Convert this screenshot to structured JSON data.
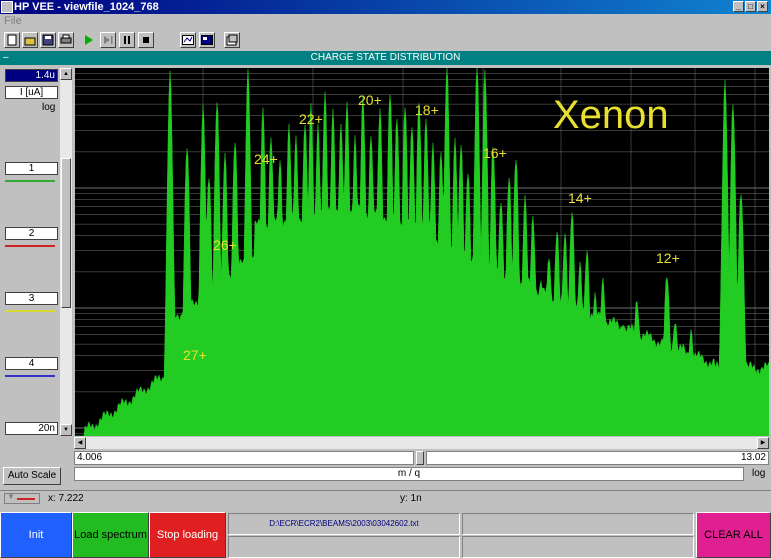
{
  "window": {
    "title": "HP VEE - viewfile_1024_768"
  },
  "menu": {
    "file": "File"
  },
  "panel": {
    "title": "CHARGE STATE DISTRIBUTION"
  },
  "yaxis": {
    "max": "1.4u",
    "unit": "I [uA]",
    "scale": "log",
    "min": "20n"
  },
  "traces": [
    {
      "label": "1",
      "color": "#33aa33"
    },
    {
      "label": "2",
      "color": "#cc2222"
    },
    {
      "label": "3",
      "color": "#d8d833"
    },
    {
      "label": "4",
      "color": "#3333cc"
    }
  ],
  "xaxis": {
    "min": "4.006",
    "max": "13.02",
    "label": "m / q",
    "scale": "log"
  },
  "plot": {
    "element_label": "Xenon",
    "charge_labels": [
      "27+",
      "26+",
      "24+",
      "22+",
      "20+",
      "18+",
      "16+",
      "14+",
      "12+"
    ]
  },
  "controls": {
    "auto_scale": "Auto Scale"
  },
  "status": {
    "x_readout": "x: 7.222",
    "y_readout": "y: 1n"
  },
  "buttons": {
    "init": "Init",
    "load": "Load spectrum",
    "stop": "Stop loading",
    "filepath": "D:\\ECR\\ECR2\\BEAMS\\2003\\03042602.txt",
    "clear": "CLEAR ALL"
  },
  "colors": {
    "spectrum": "#22cc22",
    "label": "#e8e030",
    "plot_bg": "#000000",
    "panel_bar": "#008080"
  }
}
